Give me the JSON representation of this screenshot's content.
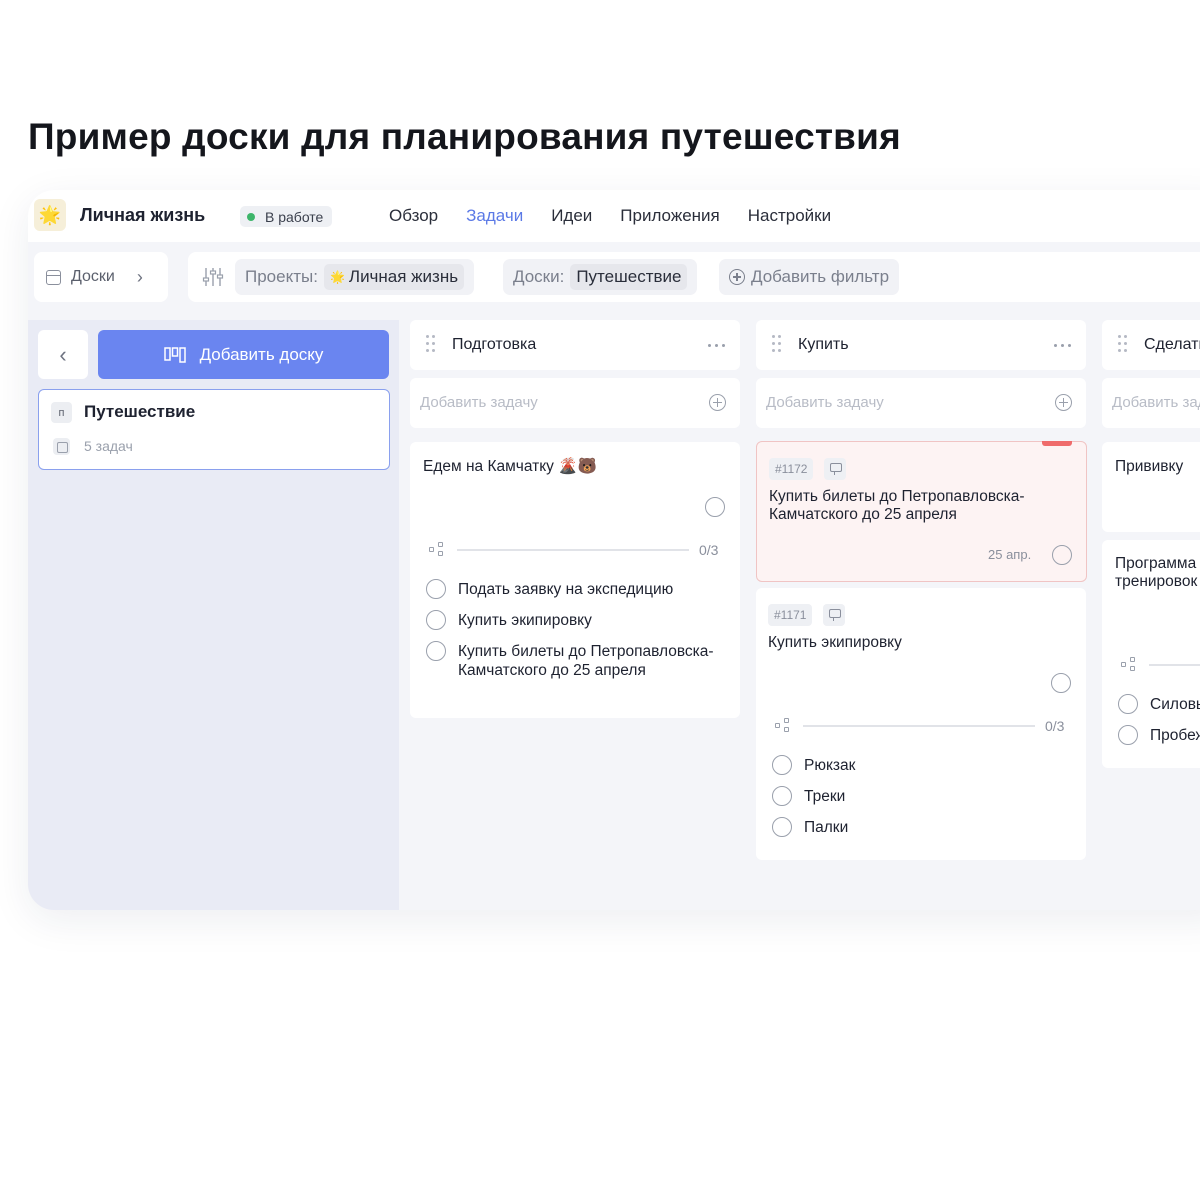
{
  "page": {
    "title": "Пример доски для планирования путешествия"
  },
  "project": {
    "icon": "star-icon",
    "name": "Личная жизнь",
    "status": "В работе",
    "status_color": "#3db56a"
  },
  "nav": [
    {
      "label": "Обзор",
      "active": false
    },
    {
      "label": "Задачи",
      "active": true
    },
    {
      "label": "Идеи",
      "active": false
    },
    {
      "label": "Приложения",
      "active": false
    },
    {
      "label": "Настройки",
      "active": false
    }
  ],
  "filterbar": {
    "boards_label": "Доски",
    "projects_key": "Проекты:",
    "projects_value": "Личная жизнь",
    "boards_key": "Доски:",
    "boards_value": "Путешествие",
    "add_filter": "Добавить фильтр"
  },
  "sidebar": {
    "add_board": "Добавить доску",
    "board": {
      "letter": "п",
      "name": "Путешествие",
      "count": "5 задач"
    }
  },
  "accent_color": "#6a85f0",
  "columns": [
    {
      "title": "Подготовка",
      "add_placeholder": "Добавить задачу",
      "cards": [
        {
          "title": "Едем на Камчатку 🌋🐻",
          "progress": "0/3",
          "checklist": [
            "Подать заявку на экспедицию",
            "Купить экипировку",
            "Купить билеты до Петропавловска-Камчатского до 25 апреля"
          ]
        }
      ]
    },
    {
      "title": "Купить",
      "add_placeholder": "Добавить задачу",
      "cards": [
        {
          "id": "#1172",
          "title": "Купить билеты до Петропавловска-Камчатского до 25 апреля",
          "date": "25 апр.",
          "urgent": true
        },
        {
          "id": "#1171",
          "title": "Купить экипировку",
          "progress": "0/3",
          "checklist": [
            "Рюкзак",
            "Треки",
            "Палки"
          ]
        }
      ]
    },
    {
      "title": "Сделать",
      "add_placeholder": "Добавить задачу",
      "cards": [
        {
          "title": "Прививку"
        },
        {
          "title": "Программа тренировок",
          "checklist": [
            "Силовые",
            "Пробежки"
          ]
        }
      ]
    }
  ]
}
